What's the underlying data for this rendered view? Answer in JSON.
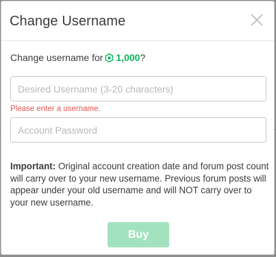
{
  "dialog": {
    "title": "Change Username",
    "close_icon": "close-icon"
  },
  "prompt": {
    "text": "Change username for",
    "price": "1,000",
    "suffix": "?",
    "currency_icon": "robux-icon",
    "accent_color": "#02b757"
  },
  "username_field": {
    "value": "",
    "placeholder": "Desired Username (3-20 characters)",
    "error": "Please enter a username."
  },
  "password_field": {
    "value": "",
    "placeholder": "Account Password"
  },
  "notice": {
    "label": "Important:",
    "text": "Original account creation date and forum post count will carry over to your new username. Previous forum posts will appear under your old username and will NOT carry over to your new username."
  },
  "actions": {
    "buy_label": "Buy",
    "buy_color": "#a3e2bf"
  }
}
